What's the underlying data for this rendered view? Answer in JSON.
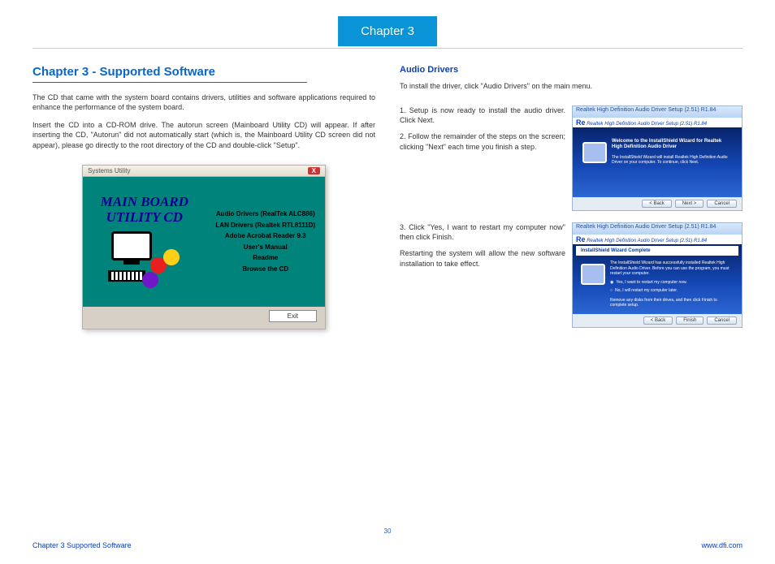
{
  "header": {
    "tab": "Chapter 3"
  },
  "left": {
    "title": "Chapter 3 - Supported Software",
    "p1": "The CD that came with the system board contains drivers, utilities and software applications required to enhance the performance of the system board.",
    "p2": "Insert the CD into a CD-ROM drive. The autorun screen (Mainboard Utility CD) will appear. If after inserting the CD, \"Autorun\" did not automatically start (which is, the Mainboard Utility CD screen did not appear), please go directly to the root directory of the CD and double-click \"Setup\".",
    "utility": {
      "windowTitle": "Systems Utility",
      "bigLine1": "MAIN BOARD",
      "bigLine2": "UTILITY  CD",
      "items": [
        "Audio Drivers (RealTek ALC886)",
        "LAN Drivers (Realtek RTL8111D)",
        "Adobe Acrobat Reader 9.3",
        "User's Manual",
        "Readme",
        "Browse the CD"
      ],
      "exit": "Exit"
    }
  },
  "right": {
    "title": "Audio Drivers",
    "intro": "To install the driver, click \"Audio Drivers\" on the main menu.",
    "step1": "1. Setup is now ready to install the audio driver. Click Next.",
    "step2": "2. Follow the remainder of the steps on the screen; clicking \"Next\" each time you finish a step.",
    "step3a": "3. Click \"Yes, I want to restart my computer now\" then click Finish.",
    "step3b": "Restarting the system will allow the new software installation to take effect.",
    "shot1": {
      "tb": "Realtek High Definition Audio Driver Setup (2.51) R1.84",
      "sub": "Realtek High Definition Audio Driver Setup (2.51) R1.84",
      "head": "Welcome to the InstallShield Wizard for Realtek High Definition Audio Driver",
      "msg": "The InstallShield Wizard will install Realtek High Definition Audio Driver on your computer. To continue, click Next.",
      "btnBack": "< Back",
      "btnNext": "Next >",
      "btnCancel": "Cancel"
    },
    "shot2": {
      "tb": "Realtek High Definition Audio Driver Setup (2.51) R1.84",
      "sub": "Realtek High Definition Audio Driver Setup (2.51) R1.84",
      "completeTitle": "InstallShield Wizard Complete",
      "msg": "The InstallShield Wizard has successfully installed Realtek High Definition Audio Driver. Before you can use the program, you must restart your computer.",
      "opt1": "Yes, I want to restart my computer now.",
      "opt2": "No, I will restart my computer later.",
      "tail": "Remove any disks from their drives, and then click Finish to complete setup.",
      "btnBack": "< Back",
      "btnFinish": "Finish",
      "btnCancel": "Cancel"
    }
  },
  "footer": {
    "left": "Chapter 3 Supported Software",
    "right": "www.dfi.com",
    "page": "30"
  }
}
